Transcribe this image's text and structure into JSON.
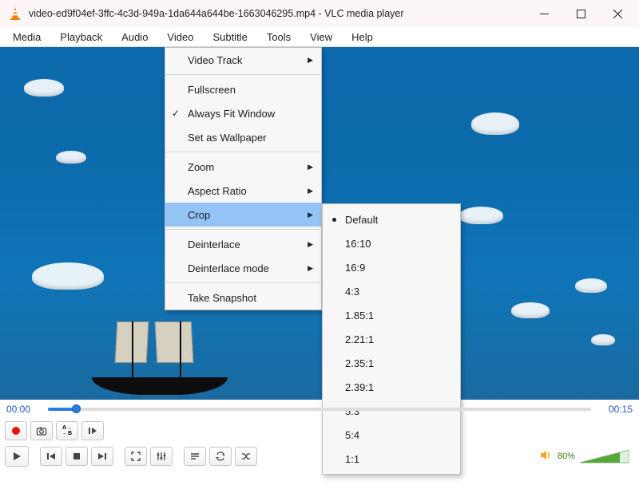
{
  "titlebar": {
    "title": "video-ed9f04ef-3ffc-4c3d-949a-1da644a644be-1663046295.mp4 - VLC media player"
  },
  "menubar": {
    "items": [
      "Media",
      "Playback",
      "Audio",
      "Video",
      "Subtitle",
      "Tools",
      "View",
      "Help"
    ]
  },
  "video_menu": {
    "items": [
      {
        "label": "Video Track",
        "submenu": true
      },
      {
        "sep": true
      },
      {
        "label": "Fullscreen"
      },
      {
        "label": "Always Fit Window",
        "checked": true
      },
      {
        "label": "Set as Wallpaper"
      },
      {
        "sep": true
      },
      {
        "label": "Zoom",
        "submenu": true
      },
      {
        "label": "Aspect Ratio",
        "submenu": true
      },
      {
        "label": "Crop",
        "submenu": true,
        "highlighted": true
      },
      {
        "sep": true
      },
      {
        "label": "Deinterlace",
        "submenu": true
      },
      {
        "label": "Deinterlace mode",
        "submenu": true
      },
      {
        "sep": true
      },
      {
        "label": "Take Snapshot"
      }
    ]
  },
  "crop_menu": {
    "items": [
      {
        "label": "Default",
        "selected": true
      },
      {
        "label": "16:10"
      },
      {
        "label": "16:9"
      },
      {
        "label": "4:3"
      },
      {
        "label": "1.85:1"
      },
      {
        "label": "2.21:1"
      },
      {
        "label": "2.35:1"
      },
      {
        "label": "2.39:1"
      },
      {
        "label": "5:3"
      },
      {
        "label": "5:4"
      },
      {
        "label": "1:1"
      }
    ]
  },
  "timeline": {
    "current": "00:00",
    "total": "00:15"
  },
  "volume": {
    "percent": "80%"
  }
}
